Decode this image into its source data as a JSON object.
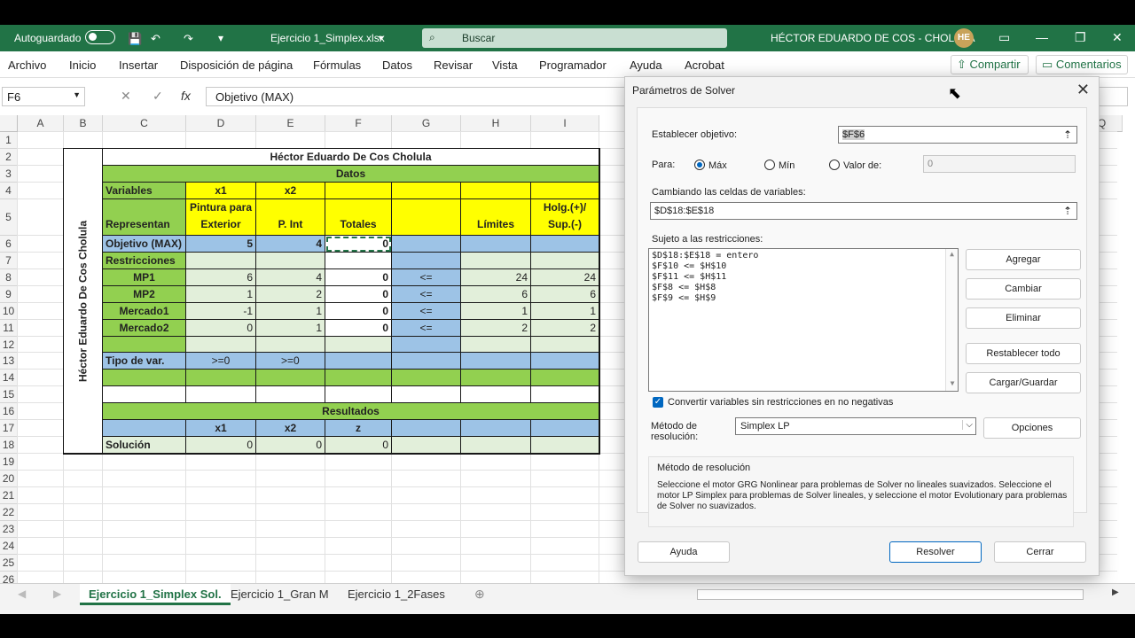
{
  "titlebar": {
    "autosave": "Autoguardado",
    "filename": "Ejercicio 1_Simplex.xlsx",
    "search": "Buscar",
    "user": "HÉCTOR EDUARDO DE COS - CHOLULA",
    "initials": "HE"
  },
  "ribbon": {
    "menus": [
      "Archivo",
      "Inicio",
      "Insertar",
      "Disposición de página",
      "Fórmulas",
      "Datos",
      "Revisar",
      "Vista",
      "Programador",
      "Ayuda",
      "Acrobat"
    ],
    "share": "Compartir",
    "comments": "Comentarios"
  },
  "formula": {
    "namebox": "F6",
    "fx": "fx",
    "value": "Objetivo (MAX)"
  },
  "columns": [
    "A",
    "B",
    "C",
    "D",
    "E",
    "F",
    "G",
    "H",
    "I",
    "Q"
  ],
  "rows": [
    "1",
    "2",
    "3",
    "4",
    "5",
    "6",
    "7",
    "8",
    "9",
    "10",
    "11",
    "12",
    "13",
    "14",
    "15",
    "16",
    "17",
    "18",
    "19",
    "20",
    "21",
    "22",
    "23",
    "24",
    "25",
    "26"
  ],
  "sheet": {
    "side_label": "Héctor Eduardo De Cos Cholula",
    "title": "Héctor Eduardo De Cos Cholula",
    "datos": "Datos",
    "variables": "Variables",
    "x1": "x1",
    "x2": "x2",
    "representan": "Representan",
    "pintura1": "Pintura para",
    "pintura2": "Exterior",
    "pint": "P. Int",
    "totales": "Totales",
    "limites": "Límites",
    "holg1": "Holg.(+)/",
    "holg2": "Sup.(-)",
    "objetivo": "Objetivo (MAX)",
    "obj_x1": "5",
    "obj_x2": "4",
    "obj_tot": "0",
    "restricciones": "Restricciones",
    "constraints": [
      {
        "name": "MP1",
        "x1": "6",
        "x2": "4",
        "tot": "0",
        "op": "<=",
        "lim": "24",
        "holg": "24"
      },
      {
        "name": "MP2",
        "x1": "1",
        "x2": "2",
        "tot": "0",
        "op": "<=",
        "lim": "6",
        "holg": "6"
      },
      {
        "name": "Mercado1",
        "x1": "-1",
        "x2": "1",
        "tot": "0",
        "op": "<=",
        "lim": "1",
        "holg": "1"
      },
      {
        "name": "Mercado2",
        "x1": "0",
        "x2": "1",
        "tot": "0",
        "op": "<=",
        "lim": "2",
        "holg": "2"
      }
    ],
    "tipo": "Tipo de var.",
    "tipo_x1": ">=0",
    "tipo_x2": ">=0",
    "resultados": "Resultados",
    "r_x1": "x1",
    "r_x2": "x2",
    "r_z": "z",
    "solucion": "Solución",
    "sol_x1": "0",
    "sol_x2": "0",
    "sol_z": "0"
  },
  "tabs": [
    "Ejercicio 1_Simplex Sol.",
    "Ejercicio 1_Gran M",
    "Ejercicio 1_2Fases"
  ],
  "solver": {
    "title": "Parámetros de Solver",
    "objective_label": "Establecer objetivo:",
    "objective": "$F$6",
    "para": "Para:",
    "max": "Máx",
    "min": "Mín",
    "valor": "Valor de:",
    "valor_val": "0",
    "changing_label": "Cambiando las celdas de variables:",
    "changing": "$D$18:$E$18",
    "subject_label": "Sujeto a las restricciones:",
    "constraints": [
      "$D$18:$E$18 = entero",
      "$F$10 <= $H$10",
      "$F$11 <= $H$11",
      "$F$8 <= $H$8",
      "$F$9 <= $H$9"
    ],
    "btn_add": "Agregar",
    "btn_change": "Cambiar",
    "btn_delete": "Eliminar",
    "btn_reset": "Restablecer todo",
    "btn_load": "Cargar/Guardar",
    "nonneg": "Convertir variables sin restricciones en no negativas",
    "method_label1": "Método de",
    "method_label2": "resolución:",
    "method": "Simplex LP",
    "options": "Opciones",
    "desc_title": "Método de resolución",
    "desc": "Seleccione el motor GRG Nonlinear para problemas de Solver no lineales suavizados. Seleccione el motor LP Simplex para problemas de Solver lineales, y seleccione el motor Evolutionary para problemas de Solver no suavizados.",
    "help": "Ayuda",
    "solve": "Resolver",
    "close": "Cerrar"
  },
  "colors": {
    "green": "#92d050",
    "yellow": "#ffff00",
    "blue": "#9dc3e6",
    "lightgreen": "#e2efda",
    "excel": "#217346"
  }
}
